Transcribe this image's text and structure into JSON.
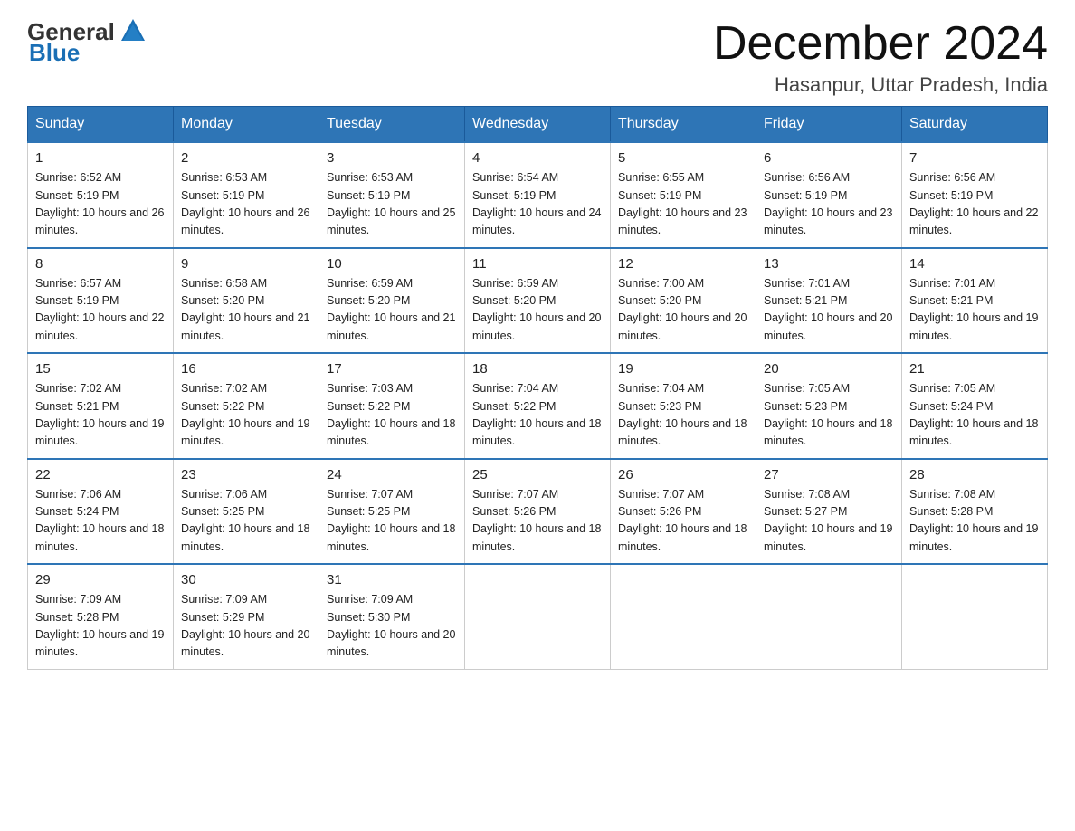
{
  "header": {
    "logo_line1": "General",
    "logo_line2": "Blue",
    "month_title": "December 2024",
    "subtitle": "Hasanpur, Uttar Pradesh, India"
  },
  "days_of_week": [
    "Sunday",
    "Monday",
    "Tuesday",
    "Wednesday",
    "Thursday",
    "Friday",
    "Saturday"
  ],
  "weeks": [
    [
      {
        "day": "1",
        "sunrise": "6:52 AM",
        "sunset": "5:19 PM",
        "daylight": "10 hours and 26 minutes."
      },
      {
        "day": "2",
        "sunrise": "6:53 AM",
        "sunset": "5:19 PM",
        "daylight": "10 hours and 26 minutes."
      },
      {
        "day": "3",
        "sunrise": "6:53 AM",
        "sunset": "5:19 PM",
        "daylight": "10 hours and 25 minutes."
      },
      {
        "day": "4",
        "sunrise": "6:54 AM",
        "sunset": "5:19 PM",
        "daylight": "10 hours and 24 minutes."
      },
      {
        "day": "5",
        "sunrise": "6:55 AM",
        "sunset": "5:19 PM",
        "daylight": "10 hours and 23 minutes."
      },
      {
        "day": "6",
        "sunrise": "6:56 AM",
        "sunset": "5:19 PM",
        "daylight": "10 hours and 23 minutes."
      },
      {
        "day": "7",
        "sunrise": "6:56 AM",
        "sunset": "5:19 PM",
        "daylight": "10 hours and 22 minutes."
      }
    ],
    [
      {
        "day": "8",
        "sunrise": "6:57 AM",
        "sunset": "5:19 PM",
        "daylight": "10 hours and 22 minutes."
      },
      {
        "day": "9",
        "sunrise": "6:58 AM",
        "sunset": "5:20 PM",
        "daylight": "10 hours and 21 minutes."
      },
      {
        "day": "10",
        "sunrise": "6:59 AM",
        "sunset": "5:20 PM",
        "daylight": "10 hours and 21 minutes."
      },
      {
        "day": "11",
        "sunrise": "6:59 AM",
        "sunset": "5:20 PM",
        "daylight": "10 hours and 20 minutes."
      },
      {
        "day": "12",
        "sunrise": "7:00 AM",
        "sunset": "5:20 PM",
        "daylight": "10 hours and 20 minutes."
      },
      {
        "day": "13",
        "sunrise": "7:01 AM",
        "sunset": "5:21 PM",
        "daylight": "10 hours and 20 minutes."
      },
      {
        "day": "14",
        "sunrise": "7:01 AM",
        "sunset": "5:21 PM",
        "daylight": "10 hours and 19 minutes."
      }
    ],
    [
      {
        "day": "15",
        "sunrise": "7:02 AM",
        "sunset": "5:21 PM",
        "daylight": "10 hours and 19 minutes."
      },
      {
        "day": "16",
        "sunrise": "7:02 AM",
        "sunset": "5:22 PM",
        "daylight": "10 hours and 19 minutes."
      },
      {
        "day": "17",
        "sunrise": "7:03 AM",
        "sunset": "5:22 PM",
        "daylight": "10 hours and 18 minutes."
      },
      {
        "day": "18",
        "sunrise": "7:04 AM",
        "sunset": "5:22 PM",
        "daylight": "10 hours and 18 minutes."
      },
      {
        "day": "19",
        "sunrise": "7:04 AM",
        "sunset": "5:23 PM",
        "daylight": "10 hours and 18 minutes."
      },
      {
        "day": "20",
        "sunrise": "7:05 AM",
        "sunset": "5:23 PM",
        "daylight": "10 hours and 18 minutes."
      },
      {
        "day": "21",
        "sunrise": "7:05 AM",
        "sunset": "5:24 PM",
        "daylight": "10 hours and 18 minutes."
      }
    ],
    [
      {
        "day": "22",
        "sunrise": "7:06 AM",
        "sunset": "5:24 PM",
        "daylight": "10 hours and 18 minutes."
      },
      {
        "day": "23",
        "sunrise": "7:06 AM",
        "sunset": "5:25 PM",
        "daylight": "10 hours and 18 minutes."
      },
      {
        "day": "24",
        "sunrise": "7:07 AM",
        "sunset": "5:25 PM",
        "daylight": "10 hours and 18 minutes."
      },
      {
        "day": "25",
        "sunrise": "7:07 AM",
        "sunset": "5:26 PM",
        "daylight": "10 hours and 18 minutes."
      },
      {
        "day": "26",
        "sunrise": "7:07 AM",
        "sunset": "5:26 PM",
        "daylight": "10 hours and 18 minutes."
      },
      {
        "day": "27",
        "sunrise": "7:08 AM",
        "sunset": "5:27 PM",
        "daylight": "10 hours and 19 minutes."
      },
      {
        "day": "28",
        "sunrise": "7:08 AM",
        "sunset": "5:28 PM",
        "daylight": "10 hours and 19 minutes."
      }
    ],
    [
      {
        "day": "29",
        "sunrise": "7:09 AM",
        "sunset": "5:28 PM",
        "daylight": "10 hours and 19 minutes."
      },
      {
        "day": "30",
        "sunrise": "7:09 AM",
        "sunset": "5:29 PM",
        "daylight": "10 hours and 20 minutes."
      },
      {
        "day": "31",
        "sunrise": "7:09 AM",
        "sunset": "5:30 PM",
        "daylight": "10 hours and 20 minutes."
      },
      null,
      null,
      null,
      null
    ]
  ]
}
